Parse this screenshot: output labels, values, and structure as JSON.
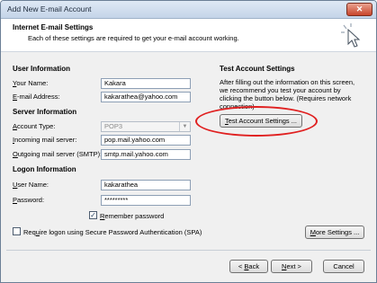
{
  "window": {
    "title": "Add New E-mail Account",
    "close_glyph": "✕"
  },
  "header": {
    "heading": "Internet E-mail Settings",
    "subheading": "Each of these settings are required to get your e-mail account working.",
    "icon": "cursor-pointer-icon"
  },
  "user_info": {
    "section": "User Information",
    "your_name": {
      "label_prefix": "",
      "label_u": "Y",
      "label_rest": "our Name:",
      "value": "Kakara"
    },
    "email": {
      "label_prefix": "",
      "label_u": "E",
      "label_rest": "-mail Address:",
      "value": "kakarathea@yahoo.com"
    }
  },
  "server_info": {
    "section": "Server Information",
    "account_type": {
      "label_prefix": "",
      "label_u": "A",
      "label_rest": "ccount Type:",
      "value": "POP3"
    },
    "incoming": {
      "label_prefix": "",
      "label_u": "I",
      "label_rest": "ncoming mail server:",
      "value": "pop.mail.yahoo.com"
    },
    "outgoing": {
      "label_prefix": "",
      "label_u": "O",
      "label_rest": "utgoing mail server (SMTP):",
      "value": "smtp.mail.yahoo.com"
    }
  },
  "logon_info": {
    "section": "Logon Information",
    "user_name": {
      "label_prefix": "",
      "label_u": "U",
      "label_rest": "ser Name:",
      "value": "kakarathea"
    },
    "password": {
      "label_prefix": "",
      "label_u": "P",
      "label_rest": "assword:",
      "value": "*********"
    },
    "remember": {
      "checked": true,
      "check_glyph": "✓",
      "label_prefix": "",
      "label_u": "R",
      "label_rest": "emember password"
    },
    "spa": {
      "checked": false,
      "label_prefix": "Req",
      "label_u": "u",
      "label_rest": "ire logon using Secure Password Authentication (SPA)"
    }
  },
  "test_settings": {
    "section": "Test Account Settings",
    "info": "After filling out the information on this screen, we recommend you test your account by clicking the button below. (Requires network connection)",
    "button": {
      "label_prefix": "",
      "label_u": "T",
      "label_rest": "est Account Settings ..."
    }
  },
  "more_settings": {
    "label_prefix": "",
    "label_u": "M",
    "label_rest": "ore Settings ..."
  },
  "footer": {
    "back": {
      "label_prefix": "< ",
      "label_u": "B",
      "label_rest": "ack"
    },
    "next": {
      "label_prefix": "",
      "label_u": "N",
      "label_rest": "ext >"
    },
    "cancel": "Cancel"
  },
  "colors": {
    "highlight": "#e02020",
    "title_text": "#1e2b3c"
  }
}
